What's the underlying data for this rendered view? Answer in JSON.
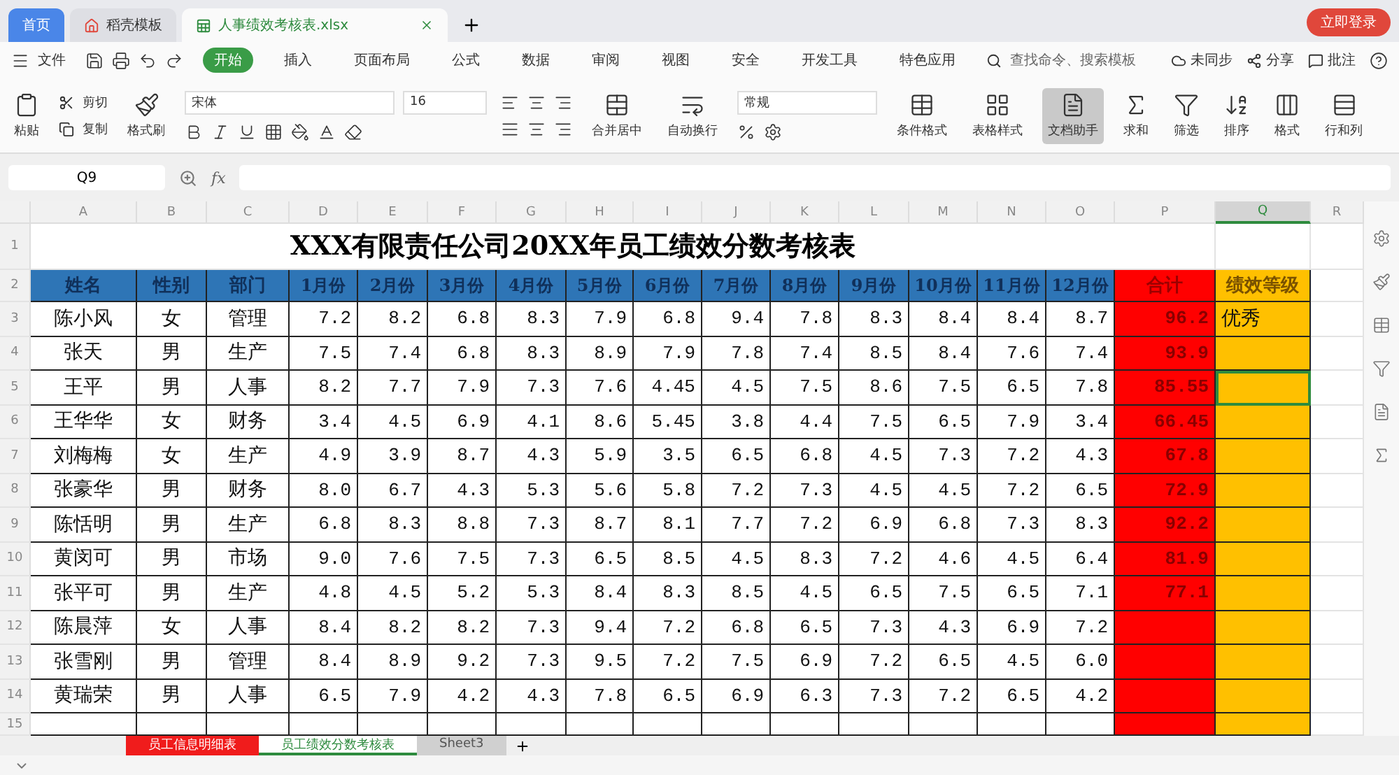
{
  "browser_tabs": [
    {
      "label": "首页",
      "selected": false,
      "kind": "home"
    },
    {
      "label": "稻壳模板",
      "selected": false,
      "kind": "app"
    },
    {
      "label": "人事绩效考核表.xlsx",
      "selected": true,
      "kind": "sheet"
    }
  ],
  "login_button": "立即登录",
  "menu": {
    "file": "文件",
    "tabs": [
      {
        "label": "开始",
        "selected": true
      },
      {
        "label": "插入",
        "selected": false
      },
      {
        "label": "页面布局",
        "selected": false
      },
      {
        "label": "公式",
        "selected": false
      },
      {
        "label": "数据",
        "selected": false
      },
      {
        "label": "审阅",
        "selected": false
      },
      {
        "label": "视图",
        "selected": false
      },
      {
        "label": "安全",
        "selected": false
      },
      {
        "label": "开发工具",
        "selected": false
      },
      {
        "label": "特色应用",
        "selected": false
      }
    ],
    "search_placeholder": "查找命令、搜索模板",
    "actions": [
      "未同步",
      "分享",
      "批注"
    ]
  },
  "ribbon": {
    "paste": "粘贴",
    "cut": "剪切",
    "copy": "复制",
    "format_painter": "格式刷",
    "font": "宋体",
    "font_size": "16",
    "merge": "合并居中",
    "wrap": "自动换行",
    "number_format": "常规",
    "tools": [
      {
        "label": "条件格式",
        "selected": false
      },
      {
        "label": "表格样式",
        "selected": false
      },
      {
        "label": "文档助手",
        "selected": true
      },
      {
        "label": "求和",
        "selected": false
      },
      {
        "label": "筛选",
        "selected": false
      },
      {
        "label": "排序",
        "selected": false
      },
      {
        "label": "格式",
        "selected": false
      },
      {
        "label": "行和列",
        "selected": false
      }
    ]
  },
  "formula_bar": {
    "name_box": "Q9",
    "fx": "fx"
  },
  "columns": [
    {
      "label": "A",
      "selected": false
    },
    {
      "label": "B",
      "selected": false
    },
    {
      "label": "C",
      "selected": false
    },
    {
      "label": "D",
      "selected": false
    },
    {
      "label": "E",
      "selected": false
    },
    {
      "label": "F",
      "selected": false
    },
    {
      "label": "G",
      "selected": false
    },
    {
      "label": "H",
      "selected": false
    },
    {
      "label": "I",
      "selected": false
    },
    {
      "label": "J",
      "selected": false
    },
    {
      "label": "K",
      "selected": false
    },
    {
      "label": "L",
      "selected": false
    },
    {
      "label": "M",
      "selected": false
    },
    {
      "label": "N",
      "selected": false
    },
    {
      "label": "O",
      "selected": false
    },
    {
      "label": "P",
      "selected": false
    },
    {
      "label": "Q",
      "selected": true
    },
    {
      "label": "R",
      "selected": false
    }
  ],
  "sheet": {
    "title": "XXX有限责任公司20XX年员工绩效分数考核表",
    "headers": [
      "姓名",
      "性别",
      "部门",
      "1月份",
      "2月份",
      "3月份",
      "4月份",
      "5月份",
      "6月份",
      "7月份",
      "8月份",
      "9月份",
      "10月份",
      "11月份",
      "12月份",
      "合计",
      "绩效等级"
    ],
    "rows": [
      {
        "row": "3",
        "name": "陈小风",
        "gender": "女",
        "dept": "管理",
        "months": [
          "7.2",
          "8.2",
          "6.8",
          "8.3",
          "7.9",
          "6.8",
          "9.4",
          "7.8",
          "8.3",
          "8.4",
          "8.4",
          "8.7"
        ],
        "total": "96.2",
        "grade": "优秀",
        "selected": false
      },
      {
        "row": "4",
        "name": "张天",
        "gender": "男",
        "dept": "生产",
        "months": [
          "7.5",
          "7.4",
          "6.8",
          "8.3",
          "8.9",
          "7.9",
          "7.8",
          "7.4",
          "8.5",
          "8.4",
          "7.6",
          "7.4"
        ],
        "total": "93.9",
        "selected": false
      },
      {
        "row": "5",
        "name": "王平",
        "gender": "男",
        "dept": "人事",
        "months": [
          "8.2",
          "7.7",
          "7.9",
          "7.3",
          "7.6",
          "4.45",
          "4.5",
          "7.5",
          "8.6",
          "7.5",
          "6.5",
          "7.8"
        ],
        "total": "85.55",
        "selected": true
      },
      {
        "row": "6",
        "name": "王华华",
        "gender": "女",
        "dept": "财务",
        "months": [
          "3.4",
          "4.5",
          "6.9",
          "4.1",
          "8.6",
          "5.45",
          "3.8",
          "4.4",
          "7.5",
          "6.5",
          "7.9",
          "3.4"
        ],
        "total": "66.45",
        "selected": false
      },
      {
        "row": "7",
        "name": "刘梅梅",
        "gender": "女",
        "dept": "生产",
        "months": [
          "4.9",
          "3.9",
          "8.7",
          "4.3",
          "5.9",
          "3.5",
          "6.5",
          "6.8",
          "4.5",
          "7.3",
          "7.2",
          "4.3"
        ],
        "total": "67.8",
        "selected": false
      },
      {
        "row": "8",
        "name": "张豪华",
        "gender": "男",
        "dept": "财务",
        "months": [
          "8.0",
          "6.7",
          "4.3",
          "5.3",
          "5.6",
          "5.8",
          "7.2",
          "7.3",
          "4.5",
          "4.5",
          "7.2",
          "6.5"
        ],
        "total": "72.9",
        "selected": false
      },
      {
        "row": "9",
        "name": "陈恬明",
        "gender": "男",
        "dept": "生产",
        "months": [
          "6.8",
          "8.3",
          "8.8",
          "7.3",
          "8.7",
          "8.1",
          "7.7",
          "7.2",
          "6.9",
          "6.8",
          "7.3",
          "8.3"
        ],
        "total": "92.2",
        "selected": false
      },
      {
        "row": "10",
        "name": "黄闵可",
        "gender": "男",
        "dept": "市场",
        "months": [
          "9.0",
          "7.6",
          "7.5",
          "7.3",
          "6.5",
          "8.5",
          "4.5",
          "8.3",
          "7.2",
          "4.6",
          "4.5",
          "6.4"
        ],
        "total": "81.9",
        "selected": false
      },
      {
        "row": "11",
        "name": "张平可",
        "gender": "男",
        "dept": "生产",
        "months": [
          "4.8",
          "4.5",
          "5.2",
          "5.3",
          "8.4",
          "8.3",
          "8.5",
          "4.5",
          "6.5",
          "7.5",
          "6.5",
          "7.1"
        ],
        "total": "77.1",
        "selected": false
      },
      {
        "row": "12",
        "name": "陈晨萍",
        "gender": "女",
        "dept": "人事",
        "months": [
          "8.4",
          "8.2",
          "8.2",
          "7.3",
          "9.4",
          "7.2",
          "6.8",
          "6.5",
          "7.3",
          "4.3",
          "6.9",
          "7.2"
        ],
        "selected": false
      },
      {
        "row": "13",
        "name": "张雪刚",
        "gender": "男",
        "dept": "管理",
        "months": [
          "8.4",
          "8.9",
          "9.2",
          "7.3",
          "9.5",
          "7.2",
          "7.5",
          "6.9",
          "7.2",
          "6.5",
          "4.5",
          "6.0"
        ],
        "selected": false
      },
      {
        "row": "14",
        "name": "黄瑞荣",
        "gender": "男",
        "dept": "人事",
        "months": [
          "6.5",
          "7.9",
          "4.2",
          "4.3",
          "7.8",
          "6.5",
          "6.9",
          "6.3",
          "7.3",
          "7.2",
          "6.5",
          "4.2"
        ],
        "selected": false
      }
    ],
    "title_row": "1",
    "header_row": "2",
    "cut_row": "15"
  },
  "sheet_tabs": [
    {
      "label": "员工信息明细表",
      "selected": false,
      "color": "#f01c1c"
    },
    {
      "label": "员工绩效分数考核表",
      "selected": true
    },
    {
      "label": "Sheet3",
      "selected": false
    }
  ]
}
